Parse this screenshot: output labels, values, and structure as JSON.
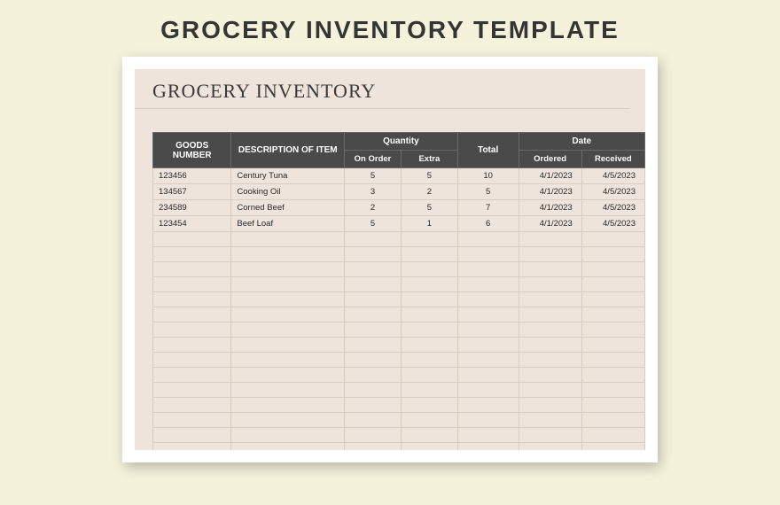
{
  "page_title": "GROCERY INVENTORY TEMPLATE",
  "doc_heading": "GROCERY INVENTORY",
  "headers": {
    "goods_number": "GOODS NUMBER",
    "description": "DESCRIPTION OF ITEM",
    "quantity": "Quantity",
    "on_order": "On Order",
    "extra": "Extra",
    "total": "Total",
    "date": "Date",
    "ordered": "Ordered",
    "received": "Received"
  },
  "rows": [
    {
      "goods": "123456",
      "desc": "Century Tuna",
      "on_order": "5",
      "extra": "5",
      "total": "10",
      "ordered": "4/1/2023",
      "received": "4/5/2023"
    },
    {
      "goods": "134567",
      "desc": "Cooking Oil",
      "on_order": "3",
      "extra": "2",
      "total": "5",
      "ordered": "4/1/2023",
      "received": "4/5/2023"
    },
    {
      "goods": "234589",
      "desc": "Corned Beef",
      "on_order": "2",
      "extra": "5",
      "total": "7",
      "ordered": "4/1/2023",
      "received": "4/5/2023"
    },
    {
      "goods": "123454",
      "desc": "Beef Loaf",
      "on_order": "5",
      "extra": "1",
      "total": "6",
      "ordered": "4/1/2023",
      "received": "4/5/2023"
    }
  ],
  "empty_rows": 15
}
